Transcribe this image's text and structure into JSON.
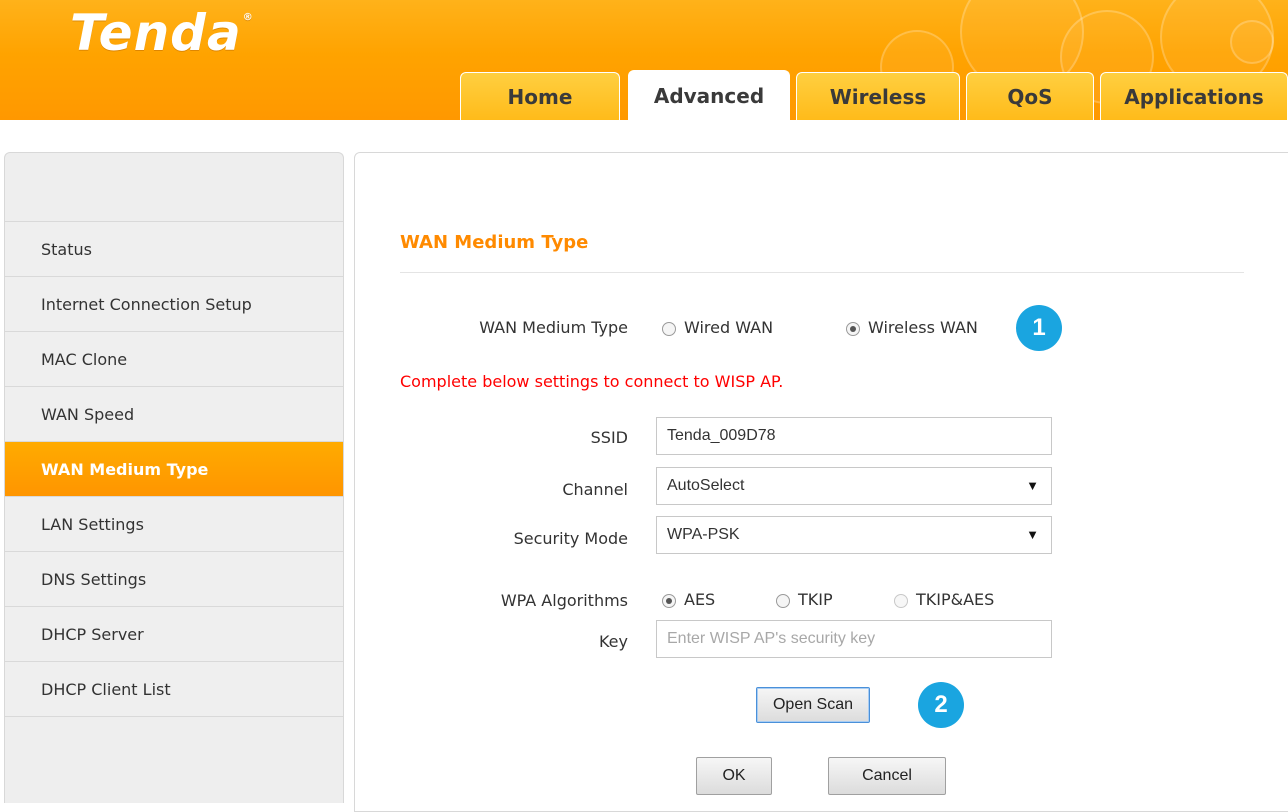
{
  "brand": {
    "logo": "Tenda",
    "registered_mark": "®"
  },
  "tabs": [
    {
      "label": "Home",
      "active": false
    },
    {
      "label": "Advanced",
      "active": true
    },
    {
      "label": "Wireless",
      "active": false
    },
    {
      "label": "QoS",
      "active": false
    },
    {
      "label": "Applications",
      "active": false
    }
  ],
  "sidebar": {
    "items": [
      {
        "label": "Status"
      },
      {
        "label": "Internet Connection Setup"
      },
      {
        "label": "MAC Clone"
      },
      {
        "label": "WAN Speed"
      },
      {
        "label": "WAN Medium Type",
        "active": true
      },
      {
        "label": "LAN Settings"
      },
      {
        "label": "DNS Settings"
      },
      {
        "label": "DHCP Server"
      },
      {
        "label": "DHCP Client List"
      }
    ]
  },
  "main": {
    "title": "WAN Medium Type",
    "medium": {
      "label": "WAN Medium Type",
      "options": [
        "Wired WAN",
        "Wireless WAN"
      ],
      "selected": "Wireless WAN"
    },
    "warning": "Complete below settings to connect to WISP AP.",
    "ssid": {
      "label": "SSID",
      "value": "Tenda_009D78"
    },
    "channel": {
      "label": "Channel",
      "value": "AutoSelect"
    },
    "security_mode": {
      "label": "Security Mode",
      "value": "WPA-PSK"
    },
    "wpa": {
      "label": "WPA Algorithms",
      "options": [
        "AES",
        "TKIP",
        "TKIP&AES"
      ],
      "selected": "AES"
    },
    "key": {
      "label": "Key",
      "placeholder": "Enter WISP AP's security key"
    },
    "open_scan": "Open Scan",
    "ok": "OK",
    "cancel": "Cancel",
    "markers": [
      "1",
      "2"
    ]
  },
  "colors": {
    "brand_orange": "#ff9800",
    "title_orange": "#ff8a00",
    "warning_red": "#ff0000",
    "marker_blue": "#1aa5e0"
  },
  "icons": {
    "dropdown": "dropdown-arrow-icon",
    "radio": "radio-icon"
  }
}
